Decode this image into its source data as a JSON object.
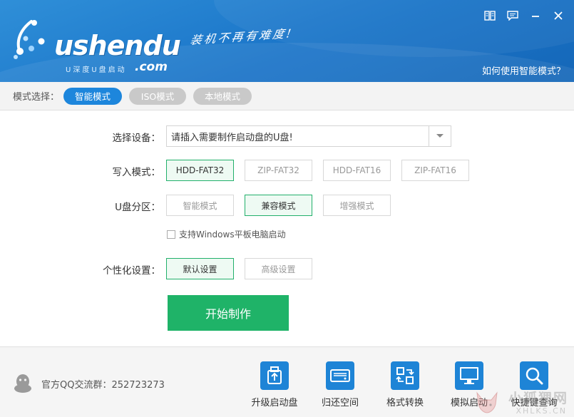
{
  "header": {
    "logo_text": "ushendu",
    "logo_sub": "U深度U盘启动",
    "logo_com": ".com",
    "slogan": "装机不再有难度!",
    "help_link": "如何使用智能模式？",
    "icons": [
      "book-icon",
      "chat-icon",
      "minimize-icon",
      "close-icon"
    ]
  },
  "modebar": {
    "label": "模式选择：",
    "modes": [
      {
        "label": "智能模式",
        "active": true
      },
      {
        "label": "ISO模式",
        "active": false
      },
      {
        "label": "本地模式",
        "active": false
      }
    ]
  },
  "form": {
    "device_label": "选择设备：",
    "device_value": "请插入需要制作启动盘的U盘!",
    "write_label": "写入模式：",
    "write_options": [
      "HDD-FAT32",
      "ZIP-FAT32",
      "HDD-FAT16",
      "ZIP-FAT16"
    ],
    "write_selected": "HDD-FAT32",
    "partition_label": "U盘分区：",
    "partition_options": [
      "智能模式",
      "兼容模式",
      "增强模式"
    ],
    "partition_selected": "兼容模式",
    "tablet_checkbox": "支持Windows平板电脑启动",
    "personal_label": "个性化设置：",
    "personal_options": [
      "默认设置",
      "高级设置"
    ],
    "personal_selected": "默认设置",
    "start_button": "开始制作"
  },
  "bottom": {
    "qq_label": "官方QQ交流群：252723273",
    "tools": [
      {
        "label": "升级启动盘",
        "icon": "upload-icon"
      },
      {
        "label": "归还空间",
        "icon": "disk-icon"
      },
      {
        "label": "格式转换",
        "icon": "convert-icon"
      },
      {
        "label": "模拟启动",
        "icon": "monitor-icon"
      },
      {
        "label": "快捷键查询",
        "icon": "magnifier-icon"
      }
    ]
  },
  "watermark": {
    "text": "小狐狸网",
    "sub": "XHLKS.CN"
  },
  "colors": {
    "header_blue": "#1a74c8",
    "accent_blue": "#1d86dc",
    "green": "#1fb368"
  }
}
